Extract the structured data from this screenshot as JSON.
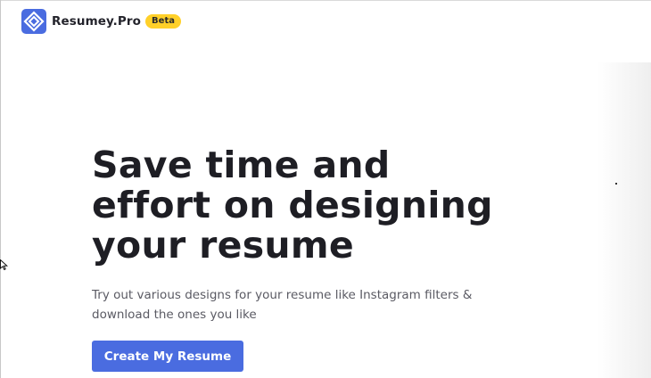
{
  "header": {
    "brand_name": "Resumey.Pro",
    "badge": "Beta",
    "logo_icon": "diamond-logo-icon"
  },
  "hero": {
    "title_line1": "Save time and",
    "title_line2": "effort on designing",
    "title_line3": "your resume",
    "subtitle_line1": "Try out various designs for your resume like Instagram filters &",
    "subtitle_line2": "download the ones you like",
    "cta_label": "Create My Resume"
  },
  "colors": {
    "brand": "#4a6ce0",
    "badge": "#ffd029",
    "text": "#1e1e24",
    "subtext": "#5a5a63"
  }
}
